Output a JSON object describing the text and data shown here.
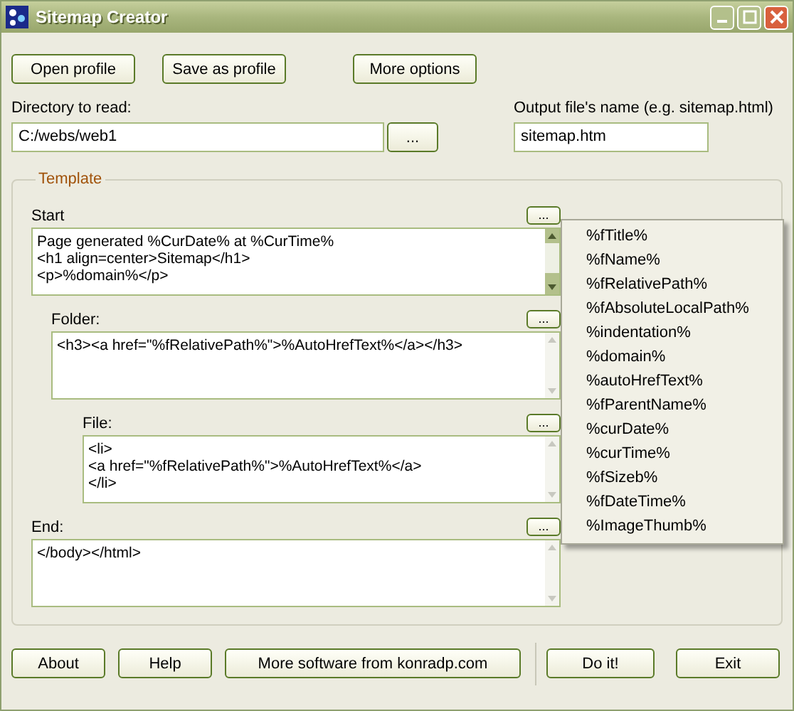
{
  "window": {
    "title": "Sitemap Creator"
  },
  "top_buttons": [
    "Open profile",
    "Save as profile",
    "More options"
  ],
  "directory": {
    "label": "Directory to read:",
    "value": "C:/webs/web1",
    "browse": "..."
  },
  "output": {
    "label": "Output file's name (e.g. sitemap.html)",
    "value": "sitemap.htm"
  },
  "template": {
    "title": "Template",
    "sections": [
      {
        "label": "Start",
        "text": "Page generated %CurDate% at %CurTime%\n<h1 align=center>Sitemap</h1>\n<p>%domain%</p>",
        "button": "...",
        "scrollable": true
      },
      {
        "label": "Folder:",
        "text": "<h3><a href=\"%fRelativePath%\">%AutoHrefText%</a></h3>",
        "button": "...",
        "scrollable": false
      },
      {
        "label": "File:",
        "text": "<li>\n<a href=\"%fRelativePath%\">%AutoHrefText%</a>\n</li>",
        "button": "...",
        "scrollable": false
      },
      {
        "label": "End:",
        "text": "</body></html>",
        "button": "...",
        "scrollable": false
      }
    ]
  },
  "menu": {
    "items": [
      "%fTitle%",
      "%fName%",
      "%fRelativePath%",
      "%fAbsoluteLocalPath%",
      "%indentation%",
      "%domain%",
      "%autoHrefText%",
      "%fParentName%",
      "%curDate%",
      "%curTime%",
      "%fSizeb%",
      "%fDateTime%",
      "%ImageThumb%"
    ]
  },
  "bottom_buttons": {
    "left": [
      "About",
      "Help",
      "More software from konradp.com"
    ],
    "right": [
      "Do it!",
      "Exit"
    ]
  }
}
